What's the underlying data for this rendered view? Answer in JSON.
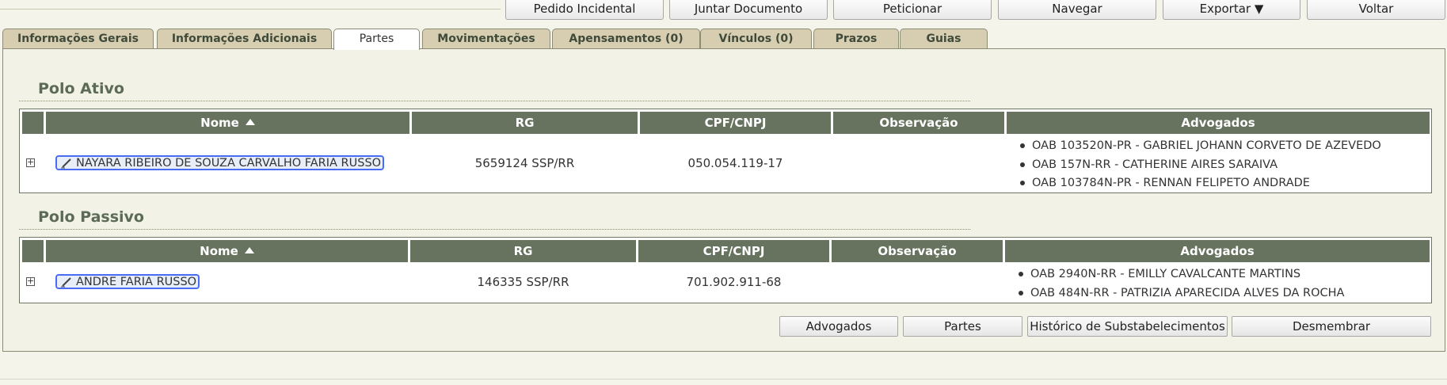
{
  "toolbar": {
    "pedido_incidental": "Pedido Incidental",
    "juntar_documento": "Juntar Documento",
    "peticionar": "Peticionar",
    "navegar": "Navegar",
    "exportar": "Exportar ▼",
    "voltar": "Voltar"
  },
  "tabs": [
    "Informações Gerais",
    "Informações Adicionais",
    "Partes",
    "Movimentações",
    "Apensamentos (0)",
    "Vínculos (0)",
    "Prazos",
    "Guias"
  ],
  "active_tab": "Partes",
  "columns": {
    "nome": "Nome",
    "rg": "RG",
    "cpf": "CPF/CNPJ",
    "observacao": "Observação",
    "advogados": "Advogados"
  },
  "polo_ativo": {
    "title": "Polo Ativo",
    "row": {
      "nome": "NAYARA RIBEIRO DE SOUZA CARVALHO FARIA RUSSO",
      "rg": "5659124 SSP/RR",
      "cpf": "050.054.119-17",
      "observacao": "",
      "advogados": [
        "OAB 103520N-PR - GABRIEL JOHANN CORVETO DE AZEVEDO",
        "OAB 157N-RR - CATHERINE AIRES SARAIVA",
        "OAB 103784N-PR - RENNAN FELIPETO ANDRADE"
      ]
    }
  },
  "polo_passivo": {
    "title": "Polo Passivo",
    "row": {
      "nome": "ANDRE FARIA RUSSO",
      "rg": "146335 SSP/RR",
      "cpf": "701.902.911-68",
      "observacao": "",
      "advogados": [
        "OAB 2940N-RR - EMILLY CAVALCANTE MARTINS",
        "OAB 484N-RR - PATRIZIA APARECIDA ALVES DA ROCHA"
      ]
    }
  },
  "bottom_buttons": {
    "advogados": "Advogados",
    "partes": "Partes",
    "historico": "Histórico de Substabelecimentos",
    "desmembrar": "Desmembrar"
  },
  "icons": {
    "expand": "plus-box-icon",
    "edit": "pencil-icon",
    "sort": "sort-ascending-icon"
  }
}
